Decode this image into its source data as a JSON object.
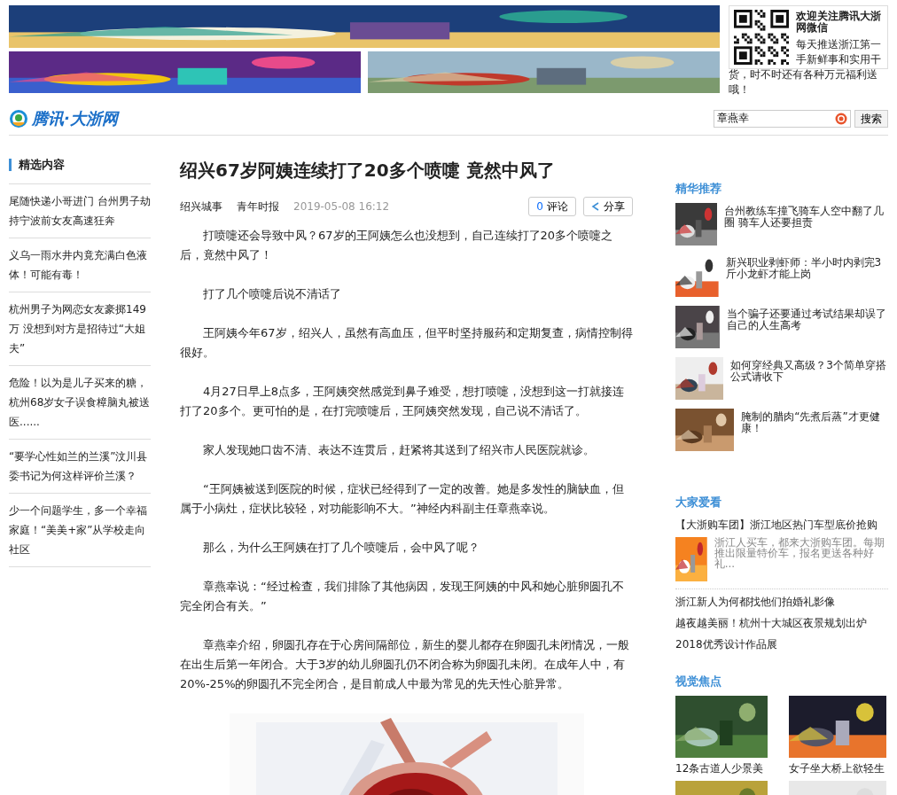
{
  "header": {
    "wechat_title": "欢迎关注腾讯大浙网微信",
    "wechat_text": "每天推送浙江第一手新鲜事和实用干货，时不时还有各种万元福利送哦！",
    "logo": "腾讯·大浙网",
    "search": {
      "value": "章燕幸",
      "button": "搜索"
    }
  },
  "left": {
    "heading": "精选内容",
    "items": [
      "尾随快递小哥进门 台州男子劫持宁波前女友高速狂奔",
      "义乌一雨水井内竟充满白色液体！可能有毒！",
      "杭州男子为网恋女友豪掷149万 没想到对方是招待过“大姐夫”",
      "危险！以为是儿子买来的糖，杭州68岁女子误食樟脑丸被送医......",
      "“要学心性如兰的兰溪”汶川县委书记为何这样评价兰溪？",
      "少一个问题学生，多一个幸福家庭！“美美+家”从学校走向社区"
    ]
  },
  "article": {
    "title": "绍兴67岁阿姨连续打了20多个喷嚏 竟然中风了",
    "source": "绍兴城事",
    "author": "青年时报",
    "time": "2019-05-08 16:12",
    "comment_count": "0",
    "comment_label": "评论",
    "share_label": "分享",
    "paragraphs": [
      "打喷嚏还会导致中风？67岁的王阿姨怎么也没想到，自己连续打了20多个喷嚏之后，竟然中风了！",
      "打了几个喷嚏后说不清话了",
      "王阿姨今年67岁，绍兴人，虽然有高血压，但平时坚持服药和定期复查，病情控制得很好。",
      "4月27日早上8点多，王阿姨突然感觉到鼻子难受，想打喷嚏，没想到这一打就接连打了20多个。更可怕的是，在打完喷嚏后，王阿姨突然发现，自己说不清话了。",
      "家人发现她口齿不清、表达不连贯后，赶紧将其送到了绍兴市人民医院就诊。",
      "“王阿姨被送到医院的时候，症状已经得到了一定的改善。她是多发性的脑缺血，但属于小病灶，症状比较轻，对功能影响不大。”神经内科副主任章燕幸说。",
      "那么，为什么王阿姨在打了几个喷嚏后，会中风了呢？",
      "章燕幸说：“经过检查，我们排除了其他病因，发现王阿姨的中风和她心脏卵圆孔不完全闭合有关。”",
      "章燕幸介绍，卵圆孔存在于心房间隔部位，新生的婴儿都存在卵圆孔未闭情况，一般在出生后第一年闭合。大于3岁的幼儿卵圆孔仍不闭合称为卵圆孔未闭。在成年人中，有20%-25%的卵圆孔不完全闭合，是目前成人中最为常见的先天性心脏异常。"
    ]
  },
  "featured": {
    "heading": "精华推荐",
    "items": [
      "台州教练车撞飞骑车人空中翻了几圈 骑车人还要担责",
      "新兴职业剥虾师：半小时内剥完3斤小龙虾才能上岗",
      "当个骗子还要通过考试结果却误了自己的人生高考",
      "如何穿经典又高级？3个简单穿搭公式请收下",
      "腌制的腊肉“先煮后蒸”才更健康！"
    ]
  },
  "popular": {
    "heading": "大家爱看",
    "lead_title": "【大浙购车团】浙江地区热门车型底价抢购",
    "lead_text": "浙江人买车，都来大浙购车团。每期推出限量特价车，报名更送各种好礼...",
    "links": [
      "浙江新人为何都找他们拍婚礼影像",
      "越夜越美丽！杭州十大城区夜景规划出炉",
      "2018优秀设计作品展"
    ]
  },
  "visual": {
    "heading": "视觉焦点",
    "items": [
      {
        "caption": "12条古道人少景美"
      },
      {
        "caption": "女子坐大桥上欲轻生"
      }
    ]
  }
}
